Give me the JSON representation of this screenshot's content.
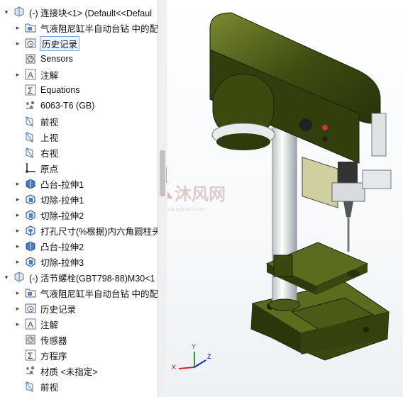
{
  "tree": {
    "rows": [
      {
        "label": "(-) 连接块<1> (Default<<Defaul",
        "icon": "part-icon",
        "level": 0
      },
      {
        "label": "气液阻尼缸半自动台钻 中的配",
        "icon": "folder-icon",
        "level": 1
      },
      {
        "label": "历史记录",
        "icon": "history-icon",
        "level": 1
      },
      {
        "label": "Sensors",
        "icon": "sensor-icon",
        "level": 1
      },
      {
        "label": "注解",
        "icon": "annotation-icon",
        "level": 1
      },
      {
        "label": "Equations",
        "icon": "equation-icon",
        "level": 1
      },
      {
        "label": "6063-T6 (GB)",
        "icon": "material-icon",
        "level": 1
      },
      {
        "label": "前视",
        "icon": "plane-icon",
        "level": 1
      },
      {
        "label": "上视",
        "icon": "plane-icon",
        "level": 1
      },
      {
        "label": "右视",
        "icon": "plane-icon",
        "level": 1
      },
      {
        "label": "原点",
        "icon": "origin-icon",
        "level": 1
      },
      {
        "label": "凸台-拉伸1",
        "icon": "boss-extrude-icon",
        "level": 1
      },
      {
        "label": "切除-拉伸1",
        "icon": "cut-extrude-icon",
        "level": 1
      },
      {
        "label": "切除-拉伸2",
        "icon": "cut-extrude-icon",
        "level": 1
      },
      {
        "label": "打孔尺寸(%根据)内六角圆柱头",
        "icon": "hole-wizard-icon",
        "level": 1
      },
      {
        "label": "凸台-拉伸2",
        "icon": "boss-extrude-icon",
        "level": 1
      },
      {
        "label": "切除-拉伸3",
        "icon": "cut-extrude-icon",
        "level": 1
      },
      {
        "label": "(-) 活节螺栓(GBT798-88)M30<1",
        "icon": "part-icon",
        "level": 0
      },
      {
        "label": "气液阻尼缸半自动台钻 中的配",
        "icon": "folder-icon",
        "level": 1
      },
      {
        "label": "历史记录",
        "icon": "history-icon",
        "level": 1
      },
      {
        "label": "注解",
        "icon": "annotation-icon",
        "level": 1
      },
      {
        "label": "传感器",
        "icon": "sensor-icon",
        "level": 1
      },
      {
        "label": "方程序",
        "icon": "equation-icon",
        "level": 1
      },
      {
        "label": "材质 <未指定>",
        "icon": "material-icon",
        "level": 1
      },
      {
        "label": "前视",
        "icon": "plane-icon",
        "level": 1
      }
    ],
    "expandable": [
      true,
      true,
      true,
      false,
      true,
      false,
      false,
      false,
      false,
      false,
      false,
      true,
      true,
      true,
      true,
      true,
      true,
      true,
      true,
      true,
      true,
      false,
      false,
      false,
      false
    ],
    "selected_index": 2
  },
  "watermark": {
    "text": "沐风网",
    "url": "www.mfcad.com"
  },
  "colors": {
    "machine": "#3c4a10",
    "machine_light": "#5a6b1e",
    "column": "#e8ecee",
    "select": "#7aa7d8"
  },
  "triad": {
    "x": "X",
    "y": "Y",
    "z": "Z"
  }
}
